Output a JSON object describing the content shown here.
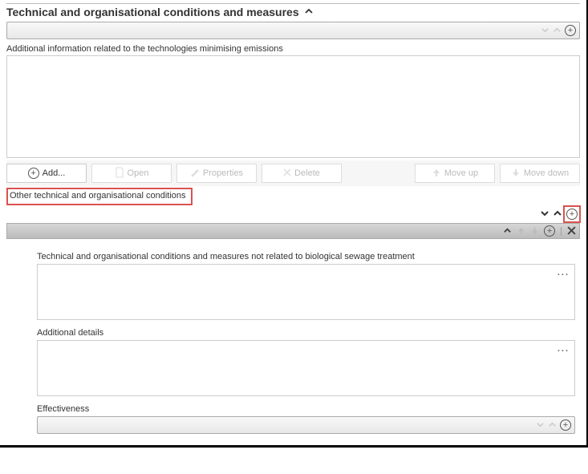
{
  "section": {
    "title": "Technical and organisational conditions and measures"
  },
  "labels": {
    "additional_info": "Additional information related to the technologies minimising emissions",
    "other_conditions": "Other technical and organisational conditions"
  },
  "buttons": {
    "add": "Add...",
    "open": "Open",
    "properties": "Properties",
    "delete": "Delete",
    "move_up": "Move up",
    "move_down": "Move down"
  },
  "record": {
    "field1_label": "Technical and organisational conditions and measures not related to biological sewage treatment",
    "field2_label": "Additional details",
    "field3_label": "Effectiveness"
  }
}
